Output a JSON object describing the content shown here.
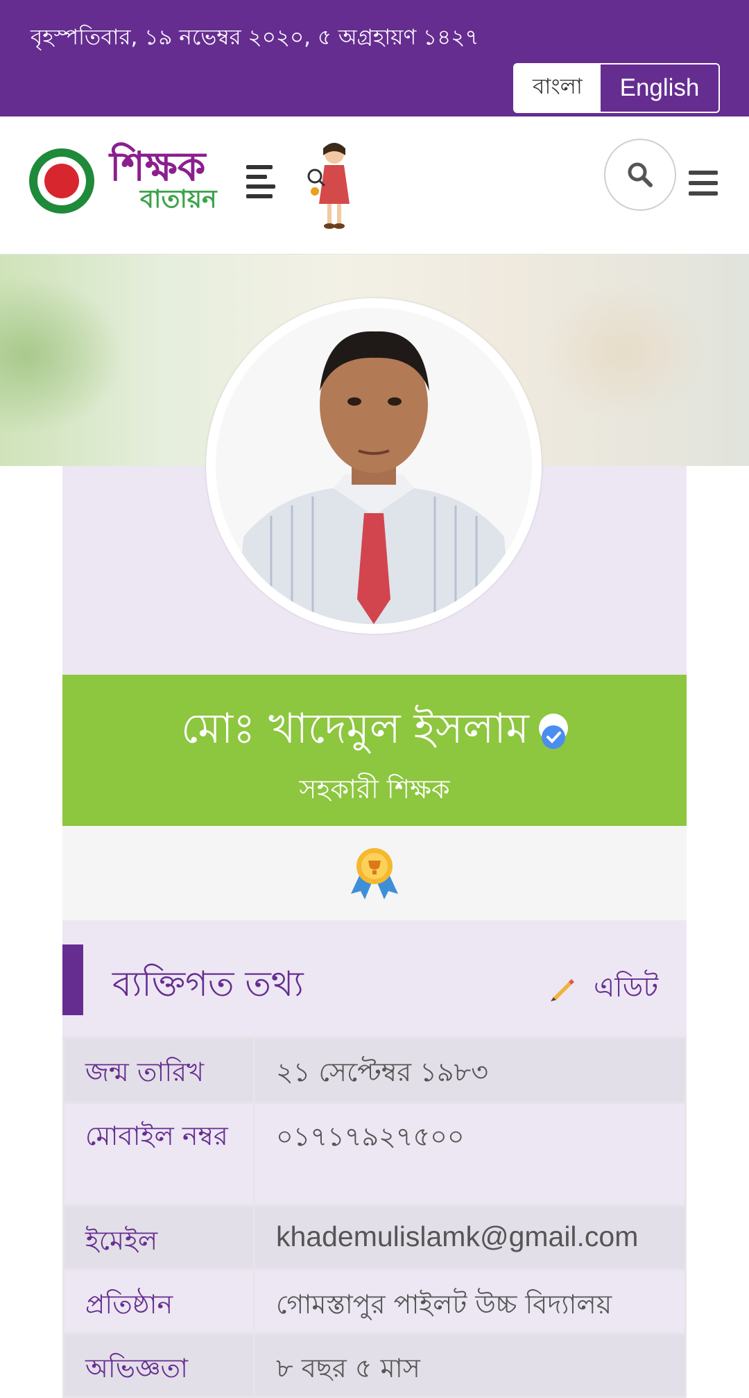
{
  "topbar": {
    "date": "বৃহস্পতিবার, ১৯ নভেম্বর ২০২০, ৫ অগ্রহায়ণ ১৪২৭",
    "lang_bn": "বাংলা",
    "lang_en": "English"
  },
  "header": {
    "logo_top": "শিক্ষক",
    "logo_bottom": "বাতায়ন",
    "icons": [
      "govt-emblem",
      "align-left-icon",
      "girl-magnifier-illustration",
      "search-icon",
      "hamburger-icon"
    ]
  },
  "profile": {
    "name": "মোঃ খাদেমুল ইসলাম",
    "designation": "সহকারী শিক্ষক",
    "verified": true
  },
  "section": {
    "title": "ব্যক্তিগত তথ্য",
    "edit_label": "এডিট"
  },
  "info": [
    {
      "key": "জন্ম তারিখ",
      "value": "২১ সেপ্টেম্বর ১৯৮৩"
    },
    {
      "key": "মোবাইল নম্বর",
      "value": "০১৭১৭৯২৭৫০০"
    },
    {
      "key": "ইমেইল",
      "value": "khademulislamk@gmail.com"
    },
    {
      "key": "প্রতিষ্ঠান",
      "value": "গোমস্তাপুর পাইলট উচ্চ বিদ্যালয়"
    },
    {
      "key": "অভিজ্ঞতা",
      "value": "৮ বছর ৫ মাস"
    }
  ],
  "colors": {
    "brand_purple": "#662d91",
    "name_green": "#8dc63f",
    "card_bg": "#ede7f3"
  }
}
